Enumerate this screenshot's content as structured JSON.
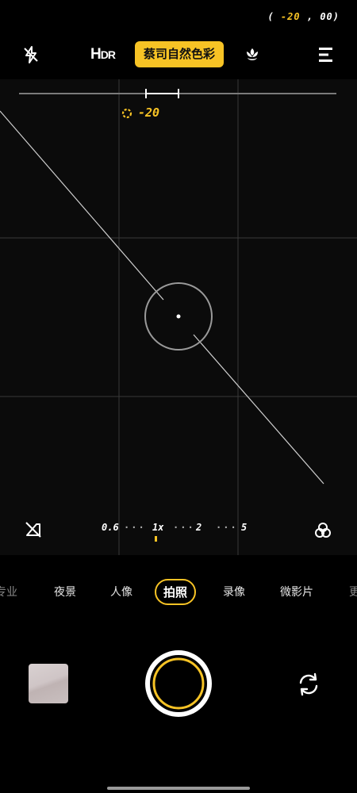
{
  "status": {
    "level_prefix": "(",
    "level_pitch": "-20",
    "level_sep": ",",
    "level_roll": "00",
    "level_suffix": ")"
  },
  "toolbar": {
    "flash_icon": "flash-off-icon",
    "hdr_main": "H",
    "hdr_rest": "DR",
    "filter_label": "蔡司自然色彩",
    "macro_icon": "macro-flower-icon",
    "menu_icon": "menu-icon"
  },
  "exposure": {
    "value": "-20",
    "icon": "exposure-dial-icon"
  },
  "zoom": {
    "levels": [
      "0.6",
      "1x",
      "2",
      "5"
    ],
    "dots": "···",
    "level_off_icon": "level-off-icon",
    "filter_icon": "color-filter-icon"
  },
  "modes": {
    "items": [
      "专业",
      "夜景",
      "人像",
      "拍照",
      "录像",
      "微影片",
      "更"
    ],
    "active": "拍照"
  },
  "bottom": {
    "gallery_icon": "gallery-thumbnail",
    "shutter_icon": "shutter-button",
    "switch_icon": "switch-camera-icon"
  },
  "colors": {
    "accent": "#f7c325",
    "background": "#000000"
  }
}
